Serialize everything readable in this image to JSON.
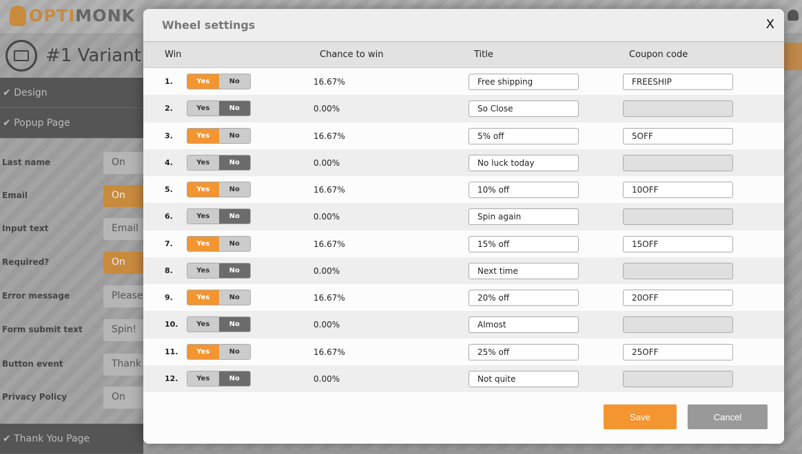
{
  "app": {
    "logo": "OPTIMONK",
    "logo_a": "OPTI",
    "logo_b": "MONK",
    "variant": "#1 Variant"
  },
  "sidebar": {
    "sections": [
      "Design",
      "Popup Page",
      "Thank You Page"
    ],
    "fields": [
      {
        "label": "Last name",
        "value": "On",
        "on": false
      },
      {
        "label": "Email",
        "value": "On",
        "on": true
      },
      {
        "label": "Input text",
        "value": "Email",
        "on": false
      },
      {
        "label": "Required?",
        "value": "On",
        "on": true
      },
      {
        "label": "Error message",
        "value": "Please e",
        "on": false
      },
      {
        "label": "Form submit text",
        "value": "Spin!",
        "on": false
      },
      {
        "label": "Button event",
        "value": "Thank Yo",
        "on": false
      },
      {
        "label": "Privacy Policy",
        "value": "On",
        "on": false
      }
    ]
  },
  "modal": {
    "title": "Wheel settings",
    "close": "X",
    "columns": [
      "Win",
      "Chance to win",
      "Title",
      "Coupon code"
    ],
    "yes": "Yes",
    "no": "No",
    "rows": [
      {
        "n": "1.",
        "win": true,
        "chance": "16.67%",
        "title": "Free shipping",
        "coupon": "FREESHIP"
      },
      {
        "n": "2.",
        "win": false,
        "chance": "0.00%",
        "title": "So Close",
        "coupon": ""
      },
      {
        "n": "3.",
        "win": true,
        "chance": "16.67%",
        "title": "5% off",
        "coupon": "5OFF"
      },
      {
        "n": "4.",
        "win": false,
        "chance": "0.00%",
        "title": "No luck today",
        "coupon": ""
      },
      {
        "n": "5.",
        "win": true,
        "chance": "16.67%",
        "title": "10% off",
        "coupon": "10OFF"
      },
      {
        "n": "6.",
        "win": false,
        "chance": "0.00%",
        "title": "Spin again",
        "coupon": ""
      },
      {
        "n": "7.",
        "win": true,
        "chance": "16.67%",
        "title": "15% off",
        "coupon": "15OFF"
      },
      {
        "n": "8.",
        "win": false,
        "chance": "0.00%",
        "title": "Next time",
        "coupon": ""
      },
      {
        "n": "9.",
        "win": true,
        "chance": "16.67%",
        "title": "20% off",
        "coupon": "20OFF"
      },
      {
        "n": "10.",
        "win": false,
        "chance": "0.00%",
        "title": "Almost",
        "coupon": ""
      },
      {
        "n": "11.",
        "win": true,
        "chance": "16.67%",
        "title": "25% off",
        "coupon": "25OFF"
      },
      {
        "n": "12.",
        "win": false,
        "chance": "0.00%",
        "title": "Not quite",
        "coupon": ""
      }
    ],
    "save": "Save",
    "cancel": "Cancel"
  },
  "colors": {
    "accent": "#f39530",
    "no_active": "#6b6b6b",
    "cancel": "#999999"
  }
}
